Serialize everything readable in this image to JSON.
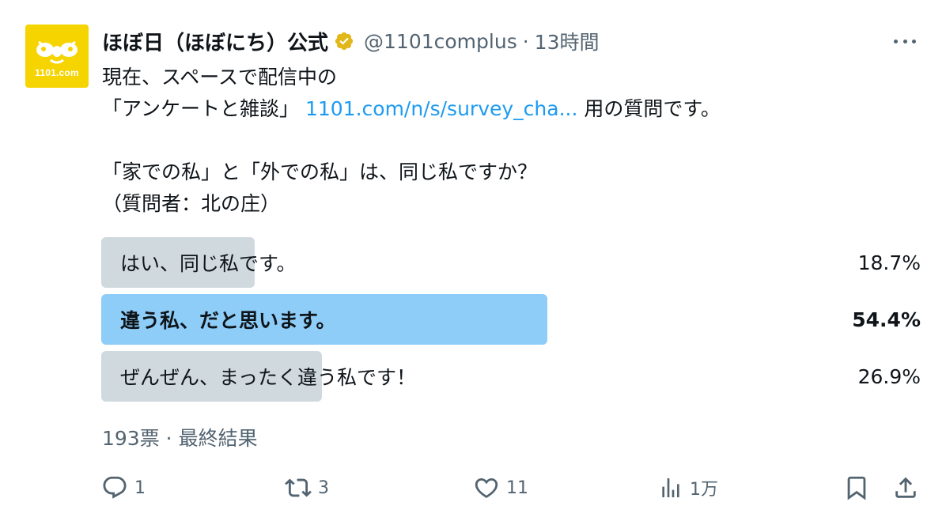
{
  "author": {
    "avatar_text": "1101.com",
    "display_name": "ほぼ日（ほぼにち）公式",
    "handle": "@1101complus",
    "separator": "·",
    "time": "13時間",
    "verified_color": "#e2b719"
  },
  "tweet": {
    "line1": "現在、スペースで配信中の",
    "line2_prefix": "「アンケートと雑談」 ",
    "link_text": "1101.com/n/s/survey_cha...",
    "line2_suffix": " 用の質問です。",
    "line3": "「家での私」と「外での私」は、同じ私ですか？",
    "line4": "（質問者：北の庄）"
  },
  "poll": {
    "options": [
      {
        "label": "はい、同じ私です。",
        "percent_text": "18.7%",
        "percent": 18.7,
        "winner": false
      },
      {
        "label": "違う私、だと思います。",
        "percent_text": "54.4%",
        "percent": 54.4,
        "winner": true
      },
      {
        "label": "ぜんぜん、まったく違う私です！",
        "percent_text": "26.9%",
        "percent": 26.9,
        "winner": false
      }
    ],
    "votes": "193票",
    "separator": "·",
    "status": "最終結果",
    "bar_color": "#cfd9de",
    "winner_color": "#8ecdf8"
  },
  "actions": {
    "reply_count": "1",
    "repost_count": "3",
    "like_count": "11",
    "views_count": "1万"
  },
  "colors": {
    "text": "#0f1419",
    "secondary": "#536471",
    "link": "#1d9bf0",
    "avatar_bg": "#f5d400"
  }
}
